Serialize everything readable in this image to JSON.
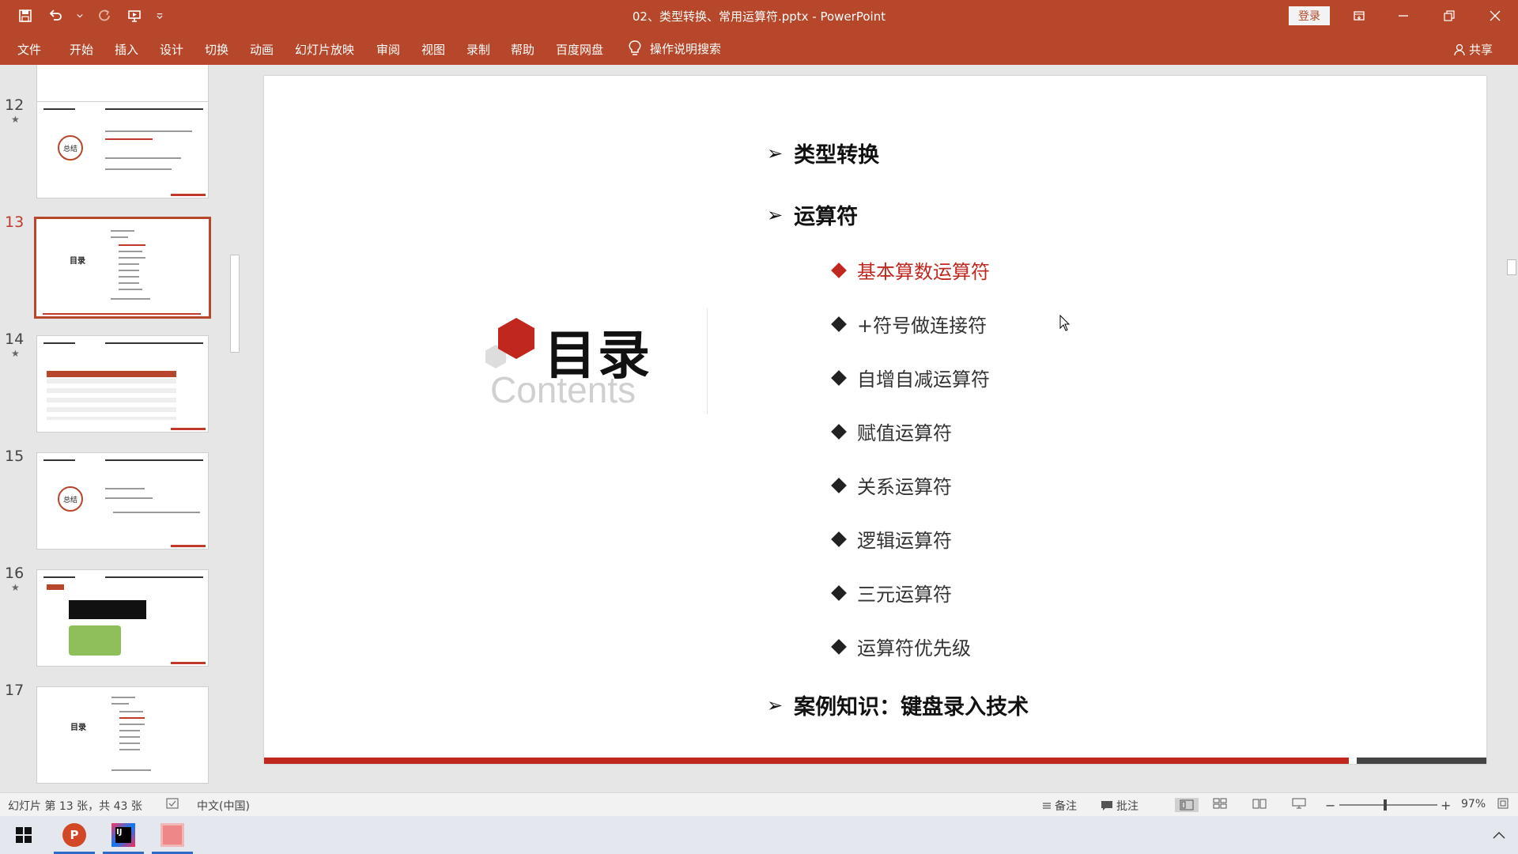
{
  "window": {
    "title": "02、类型转换、常用运算符.pptx  -  PowerPoint",
    "login_label": "登录"
  },
  "menu": {
    "items": [
      "文件",
      "开始",
      "插入",
      "设计",
      "切换",
      "动画",
      "幻灯片放映",
      "审阅",
      "视图",
      "录制",
      "帮助",
      "百度网盘"
    ],
    "tell_me": "操作说明搜索",
    "share": "共享"
  },
  "thumbnails": {
    "numbers": [
      "12",
      "13",
      "14",
      "15",
      "16",
      "17"
    ],
    "star": "★",
    "active": "13",
    "toc_label": "目录",
    "summary_label": "总结"
  },
  "slide": {
    "title": "目录",
    "subtitle": "Contents",
    "section1": "类型转换",
    "section2": "运算符",
    "items": [
      "基本算数运算符",
      "+符号做连接符",
      "自增自减运算符",
      "赋值运算符",
      "关系运算符",
      "逻辑运算符",
      "三元运算符",
      "运算符优先级"
    ],
    "highlight_index": 0,
    "section3": "案例知识：键盘录入技术"
  },
  "status": {
    "slide_info": "幻灯片 第 13 张，共 43 张",
    "language": "中文(中国)",
    "notes": "备注",
    "comments": "批注",
    "zoom": "97%",
    "zoom_minus": "−",
    "zoom_plus": "+"
  },
  "colors": {
    "accent": "#b7472a",
    "slide_red": "#c0281f"
  }
}
